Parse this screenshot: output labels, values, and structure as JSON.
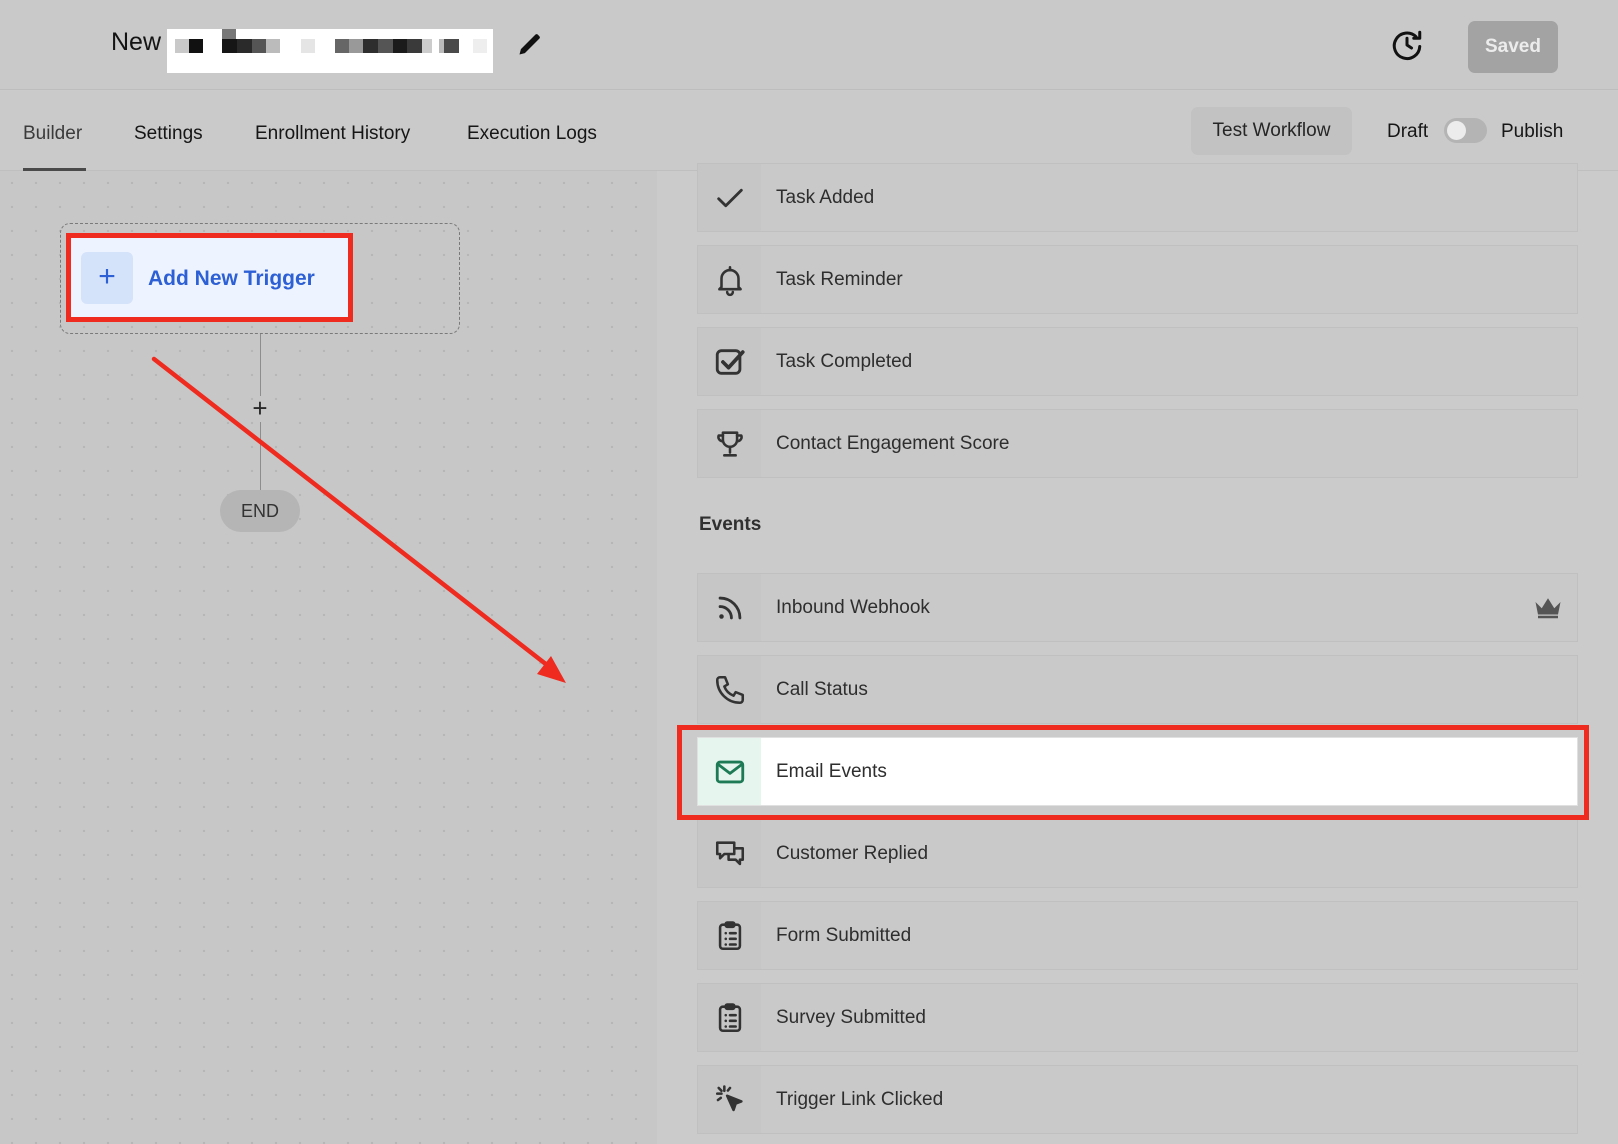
{
  "header": {
    "title_prefix": "New",
    "saved_label": "Saved"
  },
  "tabs": [
    {
      "label": "Builder",
      "active": true
    },
    {
      "label": "Settings",
      "active": false
    },
    {
      "label": "Enrollment History",
      "active": false
    },
    {
      "label": "Execution Logs",
      "active": false
    }
  ],
  "toolbar": {
    "test_label": "Test Workflow",
    "draft_label": "Draft",
    "publish_label": "Publish",
    "publish_on": false
  },
  "canvas": {
    "trigger_label": "Add New Trigger",
    "trigger_plus": "+",
    "add_step": "+",
    "end_label": "END"
  },
  "panel": {
    "items_top": [
      {
        "label": "Task Added",
        "icon": "checkmark-icon"
      },
      {
        "label": "Task Reminder",
        "icon": "bell-icon"
      },
      {
        "label": "Task Completed",
        "icon": "checkbox-checked-icon"
      },
      {
        "label": "Contact Engagement Score",
        "icon": "trophy-icon"
      }
    ],
    "events_title": "Events",
    "events": [
      {
        "label": "Inbound Webhook",
        "icon": "rss-icon",
        "premium": true
      },
      {
        "label": "Call Status",
        "icon": "phone-icon"
      },
      {
        "label": "Email Events",
        "icon": "envelope-icon",
        "highlighted": true
      },
      {
        "label": "Customer Replied",
        "icon": "chat-bubbles-icon"
      },
      {
        "label": "Form Submitted",
        "icon": "clipboard-list-icon"
      },
      {
        "label": "Survey Submitted",
        "icon": "clipboard-list-icon"
      },
      {
        "label": "Trigger Link Clicked",
        "icon": "cursor-click-icon"
      }
    ]
  },
  "colors": {
    "accent_blue": "#2d5fd5",
    "annotation_red": "#ef2a1f",
    "email_icon_green": "#1e7a55"
  }
}
